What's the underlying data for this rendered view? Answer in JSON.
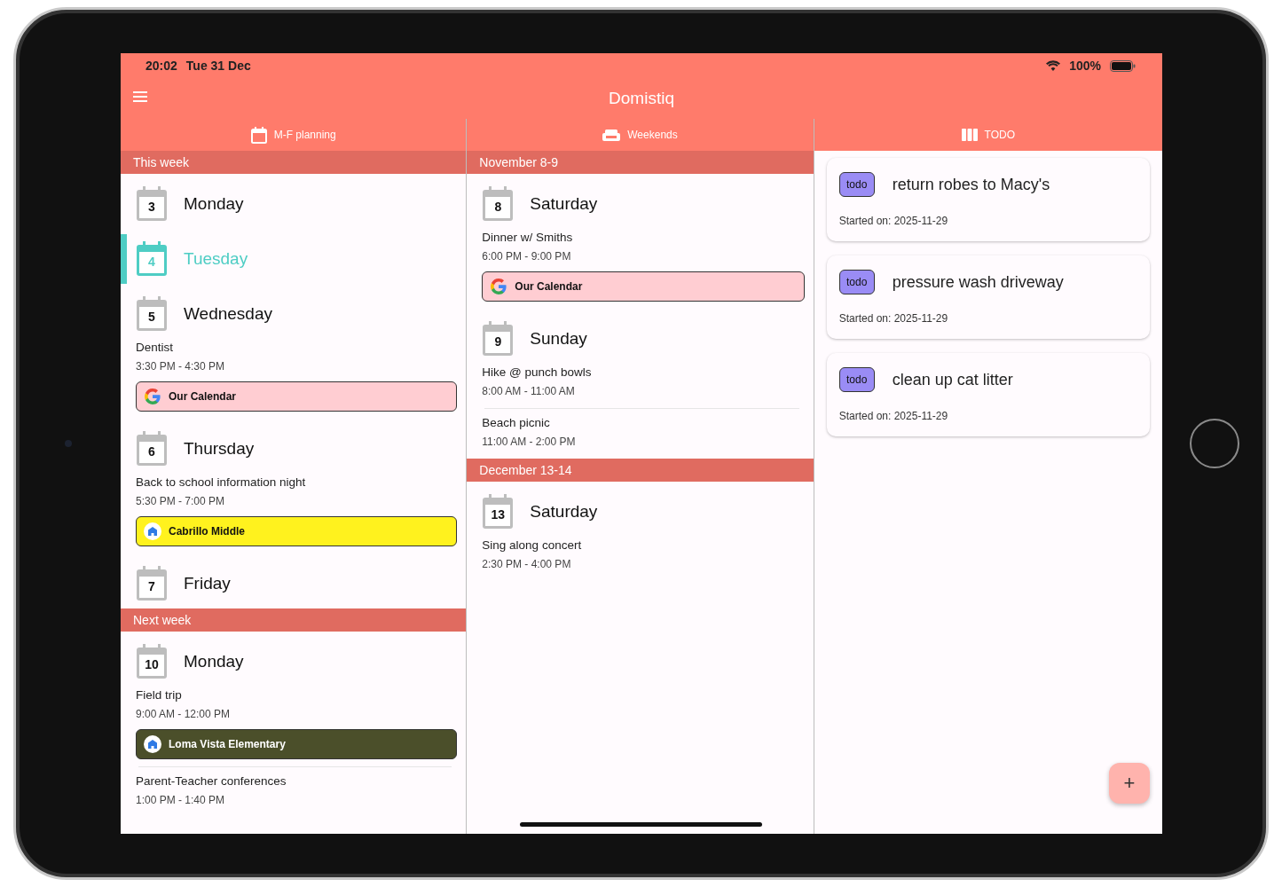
{
  "status_bar": {
    "time": "20:02",
    "date": "Tue 31 Dec",
    "battery": "100%"
  },
  "app_bar": {
    "title": "Domistiq"
  },
  "columns": [
    {
      "kind": "weekday",
      "tab": "M-F planning",
      "sections": [
        {
          "title": "This week",
          "days": [
            {
              "date": "3",
              "name": "Monday",
              "selected": false
            },
            {
              "date": "4",
              "name": "Tuesday",
              "selected": true
            },
            {
              "date": "5",
              "name": "Wednesday",
              "selected": false,
              "events": [
                {
                  "title": "Dentist",
                  "time": "3:30 PM - 4:30 PM",
                  "calendar": {
                    "kind": "google",
                    "label": "Our Calendar",
                    "color": "#ffcdd2"
                  }
                }
              ]
            },
            {
              "date": "6",
              "name": "Thursday",
              "selected": false,
              "events": [
                {
                  "title": "Back to school information night",
                  "time": "5:30 PM - 7:00 PM",
                  "calendar": {
                    "kind": "school",
                    "label": "Cabrillo Middle",
                    "color": "#fff21e"
                  }
                }
              ]
            },
            {
              "date": "7",
              "name": "Friday",
              "selected": false
            }
          ]
        },
        {
          "title": "Next week",
          "days": [
            {
              "date": "10",
              "name": "Monday",
              "selected": false,
              "events": [
                {
                  "title": "Field trip",
                  "time": "9:00 AM - 12:00 PM",
                  "calendar": {
                    "kind": "school",
                    "label": "Loma Vista Elementary",
                    "color": "#4b4f2a"
                  }
                },
                {
                  "title": "Parent-Teacher conferences",
                  "time": "1:00 PM - 1:40 PM"
                }
              ]
            }
          ]
        }
      ]
    },
    {
      "kind": "weekend",
      "tab": "Weekends",
      "sections": [
        {
          "title": "November 8-9",
          "days": [
            {
              "date": "8",
              "name": "Saturday",
              "selected": false,
              "events": [
                {
                  "title": "Dinner w/ Smiths",
                  "time": "6:00 PM - 9:00 PM",
                  "calendar": {
                    "kind": "google",
                    "label": "Our Calendar",
                    "color": "#ffcdd2"
                  }
                }
              ]
            },
            {
              "date": "9",
              "name": "Sunday",
              "selected": false,
              "events": [
                {
                  "title": "Hike @ punch bowls",
                  "time": "8:00 AM - 11:00 AM"
                },
                {
                  "title": "Beach picnic",
                  "time": "11:00 AM - 2:00 PM"
                }
              ]
            }
          ]
        },
        {
          "title": "December 13-14",
          "days": [
            {
              "date": "13",
              "name": "Saturday",
              "selected": false,
              "events": [
                {
                  "title": "Sing along concert",
                  "time": "2:30 PM - 4:00 PM"
                }
              ]
            }
          ]
        }
      ]
    },
    {
      "kind": "todo",
      "tab": "TODO",
      "todos": [
        {
          "badge": "todo",
          "title": "return robes to Macy's",
          "started": "Started on: 2025-11-29"
        },
        {
          "badge": "todo",
          "title": "pressure wash driveway",
          "started": "Started on: 2025-11-29"
        },
        {
          "badge": "todo",
          "title": "clean up cat litter",
          "started": "Started on: 2025-11-29"
        }
      ]
    }
  ],
  "fab": {
    "label": "+"
  }
}
